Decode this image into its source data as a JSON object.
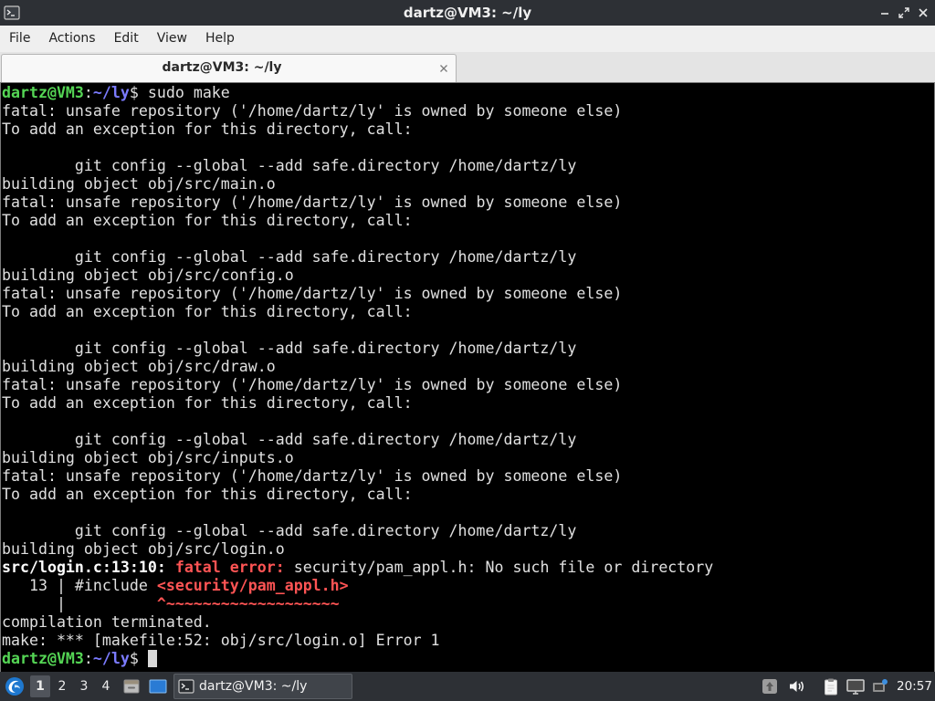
{
  "window": {
    "title": "dartz@VM3: ~/ly",
    "app_icon": "terminal-icon",
    "controls": [
      "minimize-icon",
      "maximize-icon",
      "close-icon"
    ]
  },
  "menu": {
    "items": [
      "File",
      "Actions",
      "Edit",
      "View",
      "Help"
    ]
  },
  "tabs": [
    {
      "label": "dartz@VM3: ~/ly",
      "active": true,
      "close_icon": "close-tab-icon"
    }
  ],
  "terminal": {
    "lines": [
      [
        {
          "text": "dartz@VM3",
          "style": "user"
        },
        {
          "text": ":",
          "style": "plain"
        },
        {
          "text": "~/ly",
          "style": "path"
        },
        {
          "text": "$ sudo make",
          "style": "plain"
        }
      ],
      [
        {
          "text": "fatal: unsafe repository ('/home/dartz/ly' is owned by someone else)",
          "style": "plain"
        }
      ],
      [
        {
          "text": "To add an exception for this directory, call:",
          "style": "plain"
        }
      ],
      [],
      [
        {
          "text": "        git config --global --add safe.directory /home/dartz/ly",
          "style": "plain"
        }
      ],
      [
        {
          "text": "building object obj/src/main.o",
          "style": "plain"
        }
      ],
      [
        {
          "text": "fatal: unsafe repository ('/home/dartz/ly' is owned by someone else)",
          "style": "plain"
        }
      ],
      [
        {
          "text": "To add an exception for this directory, call:",
          "style": "plain"
        }
      ],
      [],
      [
        {
          "text": "        git config --global --add safe.directory /home/dartz/ly",
          "style": "plain"
        }
      ],
      [
        {
          "text": "building object obj/src/config.o",
          "style": "plain"
        }
      ],
      [
        {
          "text": "fatal: unsafe repository ('/home/dartz/ly' is owned by someone else)",
          "style": "plain"
        }
      ],
      [
        {
          "text": "To add an exception for this directory, call:",
          "style": "plain"
        }
      ],
      [],
      [
        {
          "text": "        git config --global --add safe.directory /home/dartz/ly",
          "style": "plain"
        }
      ],
      [
        {
          "text": "building object obj/src/draw.o",
          "style": "plain"
        }
      ],
      [
        {
          "text": "fatal: unsafe repository ('/home/dartz/ly' is owned by someone else)",
          "style": "plain"
        }
      ],
      [
        {
          "text": "To add an exception for this directory, call:",
          "style": "plain"
        }
      ],
      [],
      [
        {
          "text": "        git config --global --add safe.directory /home/dartz/ly",
          "style": "plain"
        }
      ],
      [
        {
          "text": "building object obj/src/inputs.o",
          "style": "plain"
        }
      ],
      [
        {
          "text": "fatal: unsafe repository ('/home/dartz/ly' is owned by someone else)",
          "style": "plain"
        }
      ],
      [
        {
          "text": "To add an exception for this directory, call:",
          "style": "plain"
        }
      ],
      [],
      [
        {
          "text": "        git config --global --add safe.directory /home/dartz/ly",
          "style": "plain"
        }
      ],
      [
        {
          "text": "building object obj/src/login.o",
          "style": "plain"
        }
      ],
      [
        {
          "text": "src/login.c:13:10:",
          "style": "bold"
        },
        {
          "text": " ",
          "style": "plain"
        },
        {
          "text": "fatal error:",
          "style": "error"
        },
        {
          "text": " security/pam_appl.h: No such file or directory",
          "style": "plain"
        }
      ],
      [
        {
          "text": "   13 | #include ",
          "style": "plain"
        },
        {
          "text": "<security/pam_appl.h>",
          "style": "error"
        }
      ],
      [
        {
          "text": "      |          ",
          "style": "plain"
        },
        {
          "text": "^~~~~~~~~~~~~~~~~~~~",
          "style": "error"
        }
      ],
      [
        {
          "text": "compilation terminated.",
          "style": "plain"
        }
      ],
      [
        {
          "text": "make: *** [makefile:52: obj/src/login.o] Error 1",
          "style": "plain"
        }
      ],
      [
        {
          "text": "dartz@VM3",
          "style": "user"
        },
        {
          "text": ":",
          "style": "plain"
        },
        {
          "text": "~/ly",
          "style": "path"
        },
        {
          "text": "$ ",
          "style": "plain"
        }
      ]
    ],
    "cursor_visible": true
  },
  "taskbar": {
    "start_icon": "application-menu-icon",
    "desktops": [
      {
        "label": "1",
        "active": true
      },
      {
        "label": "2",
        "active": false
      },
      {
        "label": "3",
        "active": false
      },
      {
        "label": "4",
        "active": false
      }
    ],
    "quick_launch": [
      "file-manager-icon",
      "show-desktop-icon"
    ],
    "tasks": [
      {
        "label": "dartz@VM3: ~/ly",
        "icon": "terminal-icon",
        "active": true
      }
    ],
    "tray": [
      "update-icon",
      "volume-icon",
      "clipboard-icon",
      "network-icon",
      "network-status-icon"
    ],
    "clock": "20:57"
  },
  "colors": {
    "titlebar_bg": "#2d3035",
    "menubar_bg": "#efefef",
    "terminal_bg": "#000000",
    "text": "#e0e0e0",
    "bold": "#ffffff",
    "prompt_user": "#55d655",
    "prompt_path": "#7b7bff",
    "error": "#ff5454",
    "cursor": "#d9d9d9",
    "taskbar_bg": "#2d3035"
  }
}
